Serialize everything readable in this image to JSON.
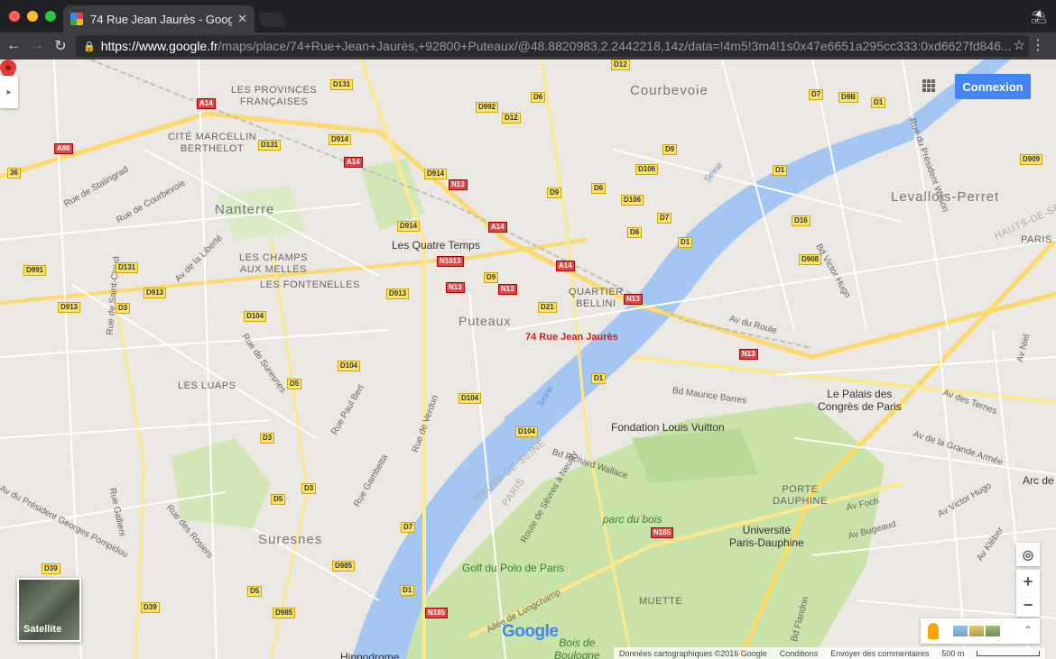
{
  "browser": {
    "tab_title": "74 Rue Jean Jaurès - Google M",
    "tab_close": "✕",
    "url_host": "https://www.google.fr",
    "url_path": "/maps/place/74+Rue+Jean+Jaurès,+92800+Puteaux/@48.8820983,2.2442218,14z/data=!4m5!3m4!1s0x47e6651a295cc333:0xd6627fd846...",
    "back_icon": "←",
    "forward_icon": "→",
    "reload_icon": "↻",
    "lock_icon": "🔒",
    "star_icon": "☆",
    "menu_icon": "⋮",
    "incognito_icon": "⛱"
  },
  "map": {
    "pin_label": "74 Rue Jean Jaurès",
    "connexion": "Connexion",
    "panel_toggle": "▸",
    "satellite": "Satellite",
    "locate": "◎",
    "zoom_in": "+",
    "zoom_out": "−",
    "expand": "⌃",
    "google": "Google",
    "footer": {
      "data": "Données cartographiques ©2016 Google",
      "conditions": "Conditions",
      "feedback": "Envoyer des commentaires",
      "scale": "500 m"
    },
    "places": {
      "courbevoie": "Courbevoie",
      "levallois": "Levallois-Perret",
      "nanterre": "Nanterre",
      "suresnes": "Suresnes",
      "puteaux": "Puteaux",
      "provinces": "LES PROVINCES\nFRANÇAISES",
      "marcellin": "CITÉ MARCELLIN\nBERTHELOT",
      "champs": "LES CHAMPS\nAUX MELLES",
      "fontenelles": "LES FONTENELLES",
      "luaps": "LES LUAPS",
      "bellini": "QUARTIER\nBELLINI",
      "porte_dauphine": "PORTE\nDAUPHINE",
      "muette": "MUETTE",
      "paris": "PARIS",
      "hauts_de_seine": "HAUTS-DE-SEINE",
      "quatre_temps": "Les Quatre Temps",
      "palais": "Le Palais des\nCongrès de Paris",
      "louis_vuitton": "Fondation Louis Vuitton",
      "dauphine": "Université\nParis-Dauphine",
      "golf": "Golf du Polo de Paris",
      "parc": "parc du bois",
      "bois": "Bois de\nBoulogne",
      "arc": "Arc de",
      "hippodrome": "Hippodrome",
      "seine": "Seine"
    },
    "streets": {
      "jean_jaures": "Rue Jean Jaurès",
      "maurice_barres": "Bd Maurice Barres",
      "richard_wallace": "Bd Richard Wallace",
      "longchamp": "Allée de Longchamp",
      "av_du_roule": "Av du Roule",
      "av_foch": "Av Foch",
      "av_victor_hugo": "Av Victor Hugo",
      "av_ternes": "Av des Ternes",
      "grande_armee": "Av de la Grande Armée",
      "rue_de_verdun": "Rue de Verdun",
      "bd_victor_hugo": "Bd Victor Hugo",
      "rue_stalingrad": "Rue de Stalingrad",
      "rue_courbevoie": "Rue de Courbevoie",
      "av_liberte": "Av de la Liberté",
      "av_president_wilson": "Rue du Président Wilson",
      "rue_de_suresnes": "Rue de Suresnes",
      "rue_gambetta": "Rue Gambetta",
      "rue_paul_bert": "Rue Paul Bert",
      "av_georges_pompidou": "Av du Président Georges Pompidou",
      "rue_gallieni": "Rue Gallieni",
      "rue_des_rosiers": "Rue des Rosiers",
      "rue_saint_cloud": "Rue de Saint-Cloud",
      "rue_de_sevres": "Route de Sèvres à Neuilly",
      "bd_bugeaud": "Av Bugeaud",
      "rue_kleber": "Av Kléber",
      "bd_flandrin": "Bd Flandrin",
      "av_neuilly": "Av Niel"
    },
    "shields": {
      "a14": "A14",
      "a86": "A86",
      "n13": "N13",
      "n1013": "N1013",
      "n185": "N185",
      "d131": "D131",
      "d914": "D914",
      "d992": "D992",
      "d12": "D12",
      "d6": "D6",
      "d9": "D9",
      "d7": "D7",
      "d9b": "D9B",
      "d1": "D1",
      "d909": "D909",
      "d106": "D106",
      "d16": "D16",
      "d908": "D908",
      "d913": "D913",
      "d104": "D104",
      "d21": "D21",
      "d5": "D5",
      "d3": "D3",
      "d985": "D985",
      "d39": "D39",
      "d991": "D991",
      "n36": "36"
    },
    "colors": {
      "water": "#a4c6f2",
      "park": "#c8e2a8",
      "road": "#ffffff",
      "major_road": "#fcd96b",
      "pin": "#e53935",
      "accent": "#4285f4"
    }
  }
}
